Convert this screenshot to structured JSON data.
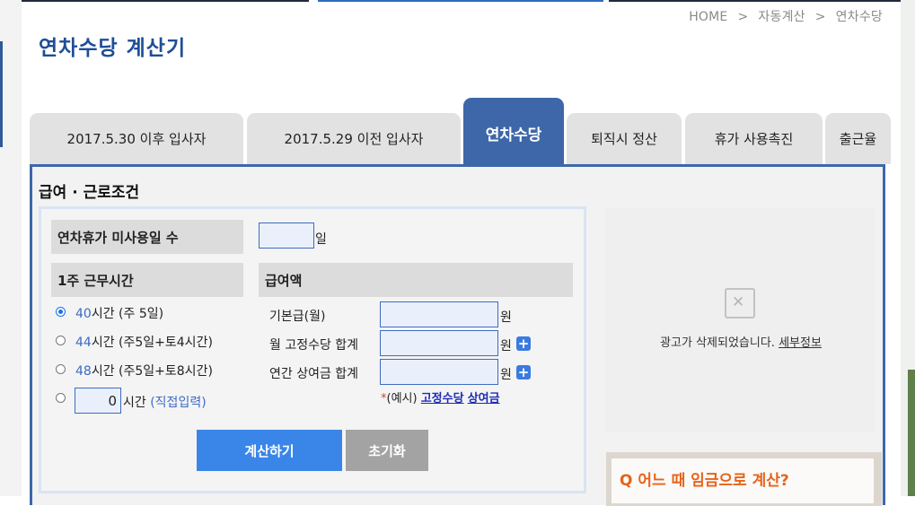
{
  "breadcrumb": {
    "home": "HOME",
    "sep": ">",
    "level1": "자동계산",
    "level2": "연차수당"
  },
  "page_title": "연차수당 계산기",
  "tabs": [
    {
      "label": "2017.5.30 이후 입사자",
      "active": false
    },
    {
      "label": "2017.5.29 이전 입사자",
      "active": false
    },
    {
      "label": "연차수당",
      "active": true
    },
    {
      "label": "퇴직시 정산",
      "active": false
    },
    {
      "label": "휴가 사용촉진",
      "active": false
    },
    {
      "label": "출근율",
      "active": false
    }
  ],
  "section_title": "급여 · 근로조건",
  "unused_leave": {
    "label": "연차휴가 미사용일 수",
    "value": "",
    "unit": "일"
  },
  "weekly_hours": {
    "label": "1주 근무시간",
    "options": [
      {
        "num": "40",
        "text": "시간 (주 5일)",
        "checked": true
      },
      {
        "num": "44",
        "text": "시간 (주5일+토4시간)",
        "checked": false
      },
      {
        "num": "48",
        "text": "시간 (주5일+토8시간)",
        "checked": false
      }
    ],
    "custom": {
      "value": "0",
      "text": "시간",
      "hint": "(직접입력)"
    }
  },
  "pay": {
    "label": "급여액",
    "fields": [
      {
        "label": "기본급(월)",
        "value": "",
        "unit": "원"
      },
      {
        "label": "월 고정수당 합계",
        "value": "",
        "unit": "원"
      },
      {
        "label": "연간 상여금 합계",
        "value": "",
        "unit": "원"
      }
    ],
    "example": {
      "star": "*",
      "prefix": "(예시)",
      "link1": "고정수당",
      "link2": "상여금"
    }
  },
  "buttons": {
    "calculate": "계산하기",
    "reset": "초기화"
  },
  "ad": {
    "icon_char": "✕",
    "message": "광고가 삭제되었습니다.",
    "details": "세부정보"
  },
  "faq": {
    "question": "Q 어느 때 임금으로 계산?"
  },
  "colors": {
    "brand": "#3d67a9",
    "calc_button": "#3a86e8",
    "reset_button": "#a3a3a3",
    "faq_accent": "#e76318"
  }
}
